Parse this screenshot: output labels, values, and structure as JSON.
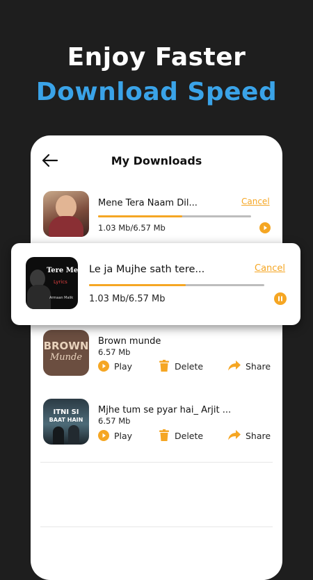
{
  "headline": {
    "line1": "Enjoy Faster",
    "line2": "Download Speed"
  },
  "screen": {
    "title": "My Downloads"
  },
  "downloads_in_progress": [
    {
      "name": "Mene Tera Naam Dil...",
      "size": "1.03 Mb/6.57 Mb",
      "cancel_label": "Cancel",
      "progress": 0.55
    },
    {
      "name": "Le ja Mujhe sath tere...",
      "size": "1.03 Mb/6.57 Mb",
      "cancel_label": "Cancel",
      "progress": 0.55,
      "thumb_text": [
        "Tere Mere",
        "Lyrics",
        "Armaan Malik"
      ]
    }
  ],
  "downloaded": [
    {
      "name": "Brown munde",
      "size": "6.57 Mb",
      "thumb_text": [
        "BROWN",
        "Munde"
      ]
    },
    {
      "name": "Mjhe tum se pyar hai_ Arjit ...",
      "size": "6.57 Mb",
      "thumb_text": [
        "ITNI SI",
        "BAAT HAIN"
      ]
    }
  ],
  "actions": {
    "play": "Play",
    "delete": "Delete",
    "share": "Share"
  },
  "colors": {
    "accent": "#f5a623",
    "blue": "#3aa3e8",
    "background": "#1e1e1e"
  }
}
